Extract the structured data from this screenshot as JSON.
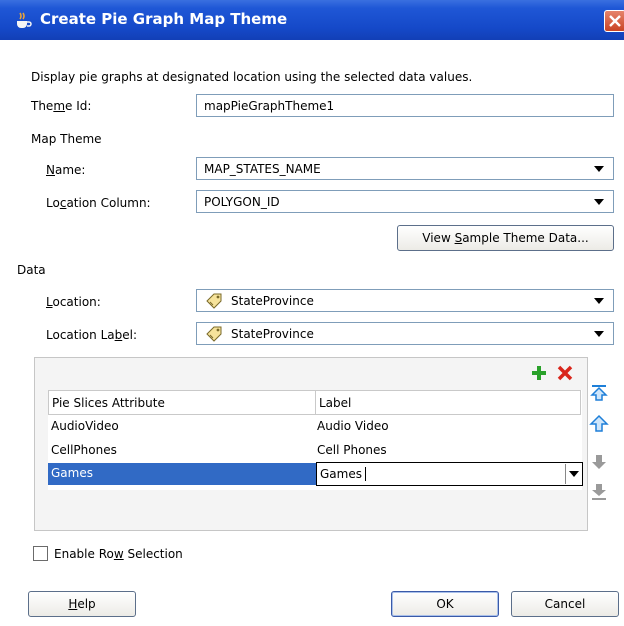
{
  "window": {
    "title": "Create Pie Graph Map Theme",
    "title_icon": "java-cup-icon",
    "close_icon": "close-icon"
  },
  "intro": "Display pie graphs at designated location using the selected data values.",
  "theme_id": {
    "label_pre": "The",
    "label_mn": "m",
    "label_post": "e Id:",
    "value": "mapPieGraphTheme1"
  },
  "map_theme": {
    "heading": "Map Theme",
    "name": {
      "label_mn": "N",
      "label_post": "ame:",
      "value": "MAP_STATES_NAME"
    },
    "location_column": {
      "label_pre": "Lo",
      "label_mn": "c",
      "label_post": "ation Column:",
      "value": "POLYGON_ID"
    },
    "view_sample": {
      "pre": "View ",
      "mn": "S",
      "post": "ample Theme Data..."
    }
  },
  "data": {
    "heading": "Data",
    "location": {
      "label_mn": "L",
      "label_post": "ocation:",
      "value": "StateProvince",
      "icon": "tag-icon"
    },
    "location_label": {
      "label_pre": "Location La",
      "label_mn": "b",
      "label_post": "el:",
      "value": "StateProvince",
      "icon": "tag-icon"
    }
  },
  "table": {
    "add_icon": "add-icon",
    "delete_icon": "delete-icon",
    "columns": [
      "Pie Slices Attribute",
      "Label"
    ],
    "rows": [
      {
        "attribute": "AudioVideo",
        "label": "Audio Video"
      },
      {
        "attribute": "CellPhones",
        "label": "Cell Phones"
      },
      {
        "attribute": "Games",
        "label": "Games"
      }
    ],
    "selected_index": 2,
    "side_icons": [
      "move-top-icon",
      "move-up-icon",
      "move-down-icon",
      "move-bottom-icon"
    ]
  },
  "enable_row_selection": {
    "pre": "Enable Ro",
    "mn": "w",
    "post": " Selection",
    "checked": false
  },
  "buttons": {
    "help": {
      "mn": "H",
      "post": "elp"
    },
    "ok": "OK",
    "cancel": "Cancel"
  },
  "colors": {
    "title_bar": "#1f57d6",
    "selection": "#316ac5",
    "add": "#2aa12a",
    "delete": "#d9261c",
    "arrow_active": "#1e7fd8",
    "arrow_disabled": "#9a9a9a"
  }
}
